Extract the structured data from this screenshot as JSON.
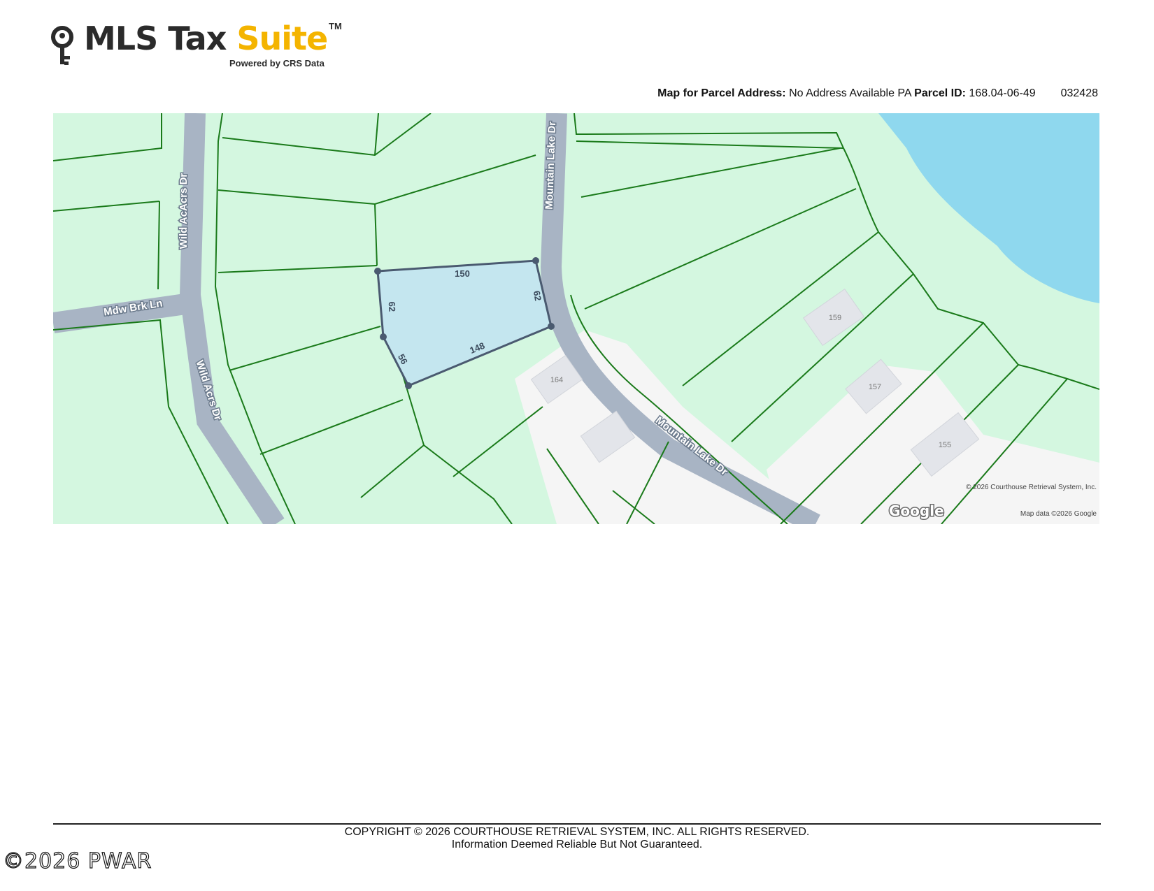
{
  "logo": {
    "brand_main": "MLS Tax ",
    "brand_accent": "Suite",
    "trademark": "TM",
    "tagline": "Powered by CRS Data"
  },
  "header": {
    "map_label": "Map for Parcel Address:",
    "address": "No Address Available PA",
    "parcel_label": "Parcel ID:",
    "parcel_id": "168.04-06-49",
    "code": "032428"
  },
  "map": {
    "roads": {
      "wild_acacrs": "Wild AcAcrs Dr",
      "wild_acrs": "Wild Acrs Dr",
      "mdw_brk": "Mdw Brk Ln",
      "mountain_lake_top": "Mountain Lake Dr",
      "mountain_lake_bottom": "Mountain Lake Dr"
    },
    "parcel_dimensions": {
      "top": "150",
      "left": "62",
      "right": "62",
      "bottom_right": "148",
      "bottom_left": "56"
    },
    "houses": [
      "164",
      "159",
      "157",
      "155"
    ],
    "credit_copyright": "© 2026 Courthouse Retrieval System, Inc.",
    "credit_google": "Google",
    "credit_mapdata": "Map data ©2026 Google",
    "colors": {
      "parcel_fill": "#d4f7e0",
      "parcel_line": "#1a7a1a",
      "road": "#a8b4c4",
      "water": "#8fd8ee",
      "developed": "#f5f5f5",
      "subject_fill": "#c4e6ef",
      "subject_line": "#4a5a70"
    }
  },
  "footer": {
    "copyright": "COPYRIGHT © 2026 COURTHOUSE RETRIEVAL SYSTEM, INC. ALL RIGHTS RESERVED.",
    "disclaimer": "Information Deemed Reliable But Not Guaranteed.",
    "watermark": "©2026 PWAR"
  }
}
